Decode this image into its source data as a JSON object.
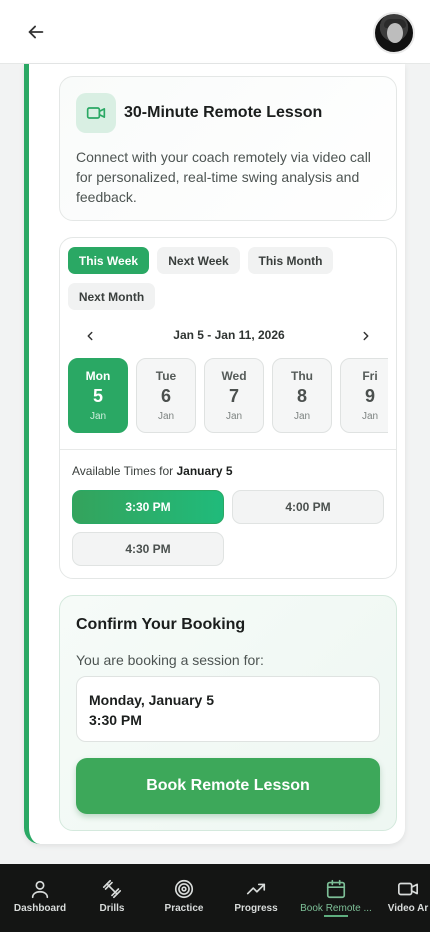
{
  "header": {
    "back_icon": "arrow-left-icon",
    "avatar_icon": "user-avatar"
  },
  "lesson": {
    "icon": "video-camera-icon",
    "title": "30-Minute Remote Lesson",
    "description": "Connect with your coach remotely via video call for personalized, real-time swing analysis and feedback."
  },
  "filters": {
    "items": [
      "This Week",
      "Next Week",
      "This Month",
      "Next Month"
    ],
    "selected": "This Week"
  },
  "calendar": {
    "range_label": "Jan 5 - Jan 11, 2026",
    "prev_icon": "chevron-left-icon",
    "next_icon": "chevron-right-icon",
    "days": [
      {
        "name": "Mon",
        "num": "5",
        "month": "Jan",
        "selected": true
      },
      {
        "name": "Tue",
        "num": "6",
        "month": "Jan",
        "selected": false
      },
      {
        "name": "Wed",
        "num": "7",
        "month": "Jan",
        "selected": false
      },
      {
        "name": "Thu",
        "num": "8",
        "month": "Jan",
        "selected": false
      },
      {
        "name": "Fri",
        "num": "9",
        "month": "Jan",
        "selected": false
      }
    ]
  },
  "times": {
    "label_prefix": "Available Times for",
    "label_date": "January 5",
    "slots": [
      "3:30 PM",
      "4:00 PM",
      "4:30 PM"
    ],
    "selected": "3:30 PM"
  },
  "confirm": {
    "title": "Confirm Your Booking",
    "subtitle": "You are booking a session for:",
    "date": "Monday, January 5",
    "time": "3:30 PM",
    "button": "Book Remote Lesson"
  },
  "bottom_nav": {
    "items": [
      {
        "label": "Dashboard",
        "icon": "user-icon"
      },
      {
        "label": "Drills",
        "icon": "dumbbell-icon"
      },
      {
        "label": "Practice",
        "icon": "target-icon"
      },
      {
        "label": "Progress",
        "icon": "trending-up-icon"
      },
      {
        "label": "Book Remote ...",
        "icon": "calendar-icon"
      },
      {
        "label": "Video Ar",
        "icon": "video-icon"
      }
    ],
    "active": "Book Remote ..."
  },
  "colors": {
    "accent": "#2aa864",
    "accent_light": "#d9efe3",
    "nav_bg": "#141514"
  }
}
